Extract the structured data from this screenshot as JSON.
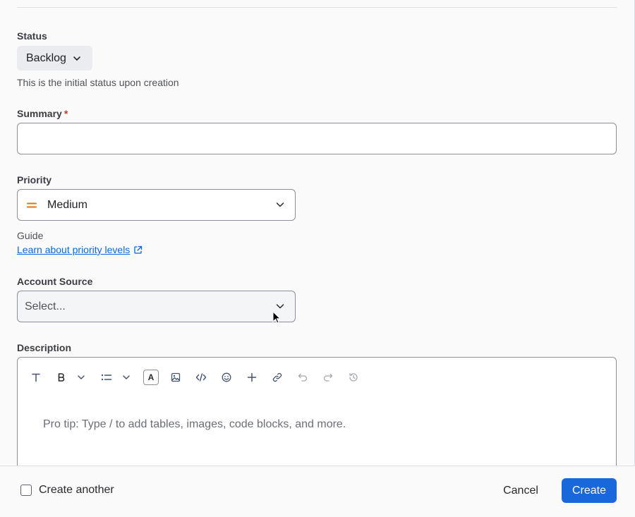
{
  "status": {
    "label": "Status",
    "value": "Backlog",
    "helper": "This is the initial status upon creation"
  },
  "summary": {
    "label": "Summary",
    "required_mark": "*",
    "value": ""
  },
  "priority": {
    "label": "Priority",
    "value": "Medium",
    "icon": "priority-medium-icon",
    "icon_color": "#e2740b",
    "guide_label": "Guide",
    "guide_link": "Learn about priority levels"
  },
  "account_source": {
    "label": "Account Source",
    "placeholder": "Select..."
  },
  "description": {
    "label": "Description",
    "placeholder": "Pro tip: Type / to add tables, images, code blocks, and more.",
    "toolbar": [
      "text-style-icon",
      "bold-icon",
      "more-formatting-chevron-icon",
      "list-icon",
      "list-chevron-icon",
      "text-color-icon",
      "image-icon",
      "code-icon",
      "emoji-icon",
      "insert-plus-icon",
      "link-icon",
      "undo-icon",
      "redo-icon",
      "history-icon"
    ],
    "text_color_glyph": "A"
  },
  "footer": {
    "create_another_label": "Create another",
    "create_another_checked": false,
    "cancel_label": "Cancel",
    "create_label": "Create"
  },
  "colors": {
    "primary": "#1868db",
    "link": "#0c66e4",
    "required": "#c9372c"
  }
}
